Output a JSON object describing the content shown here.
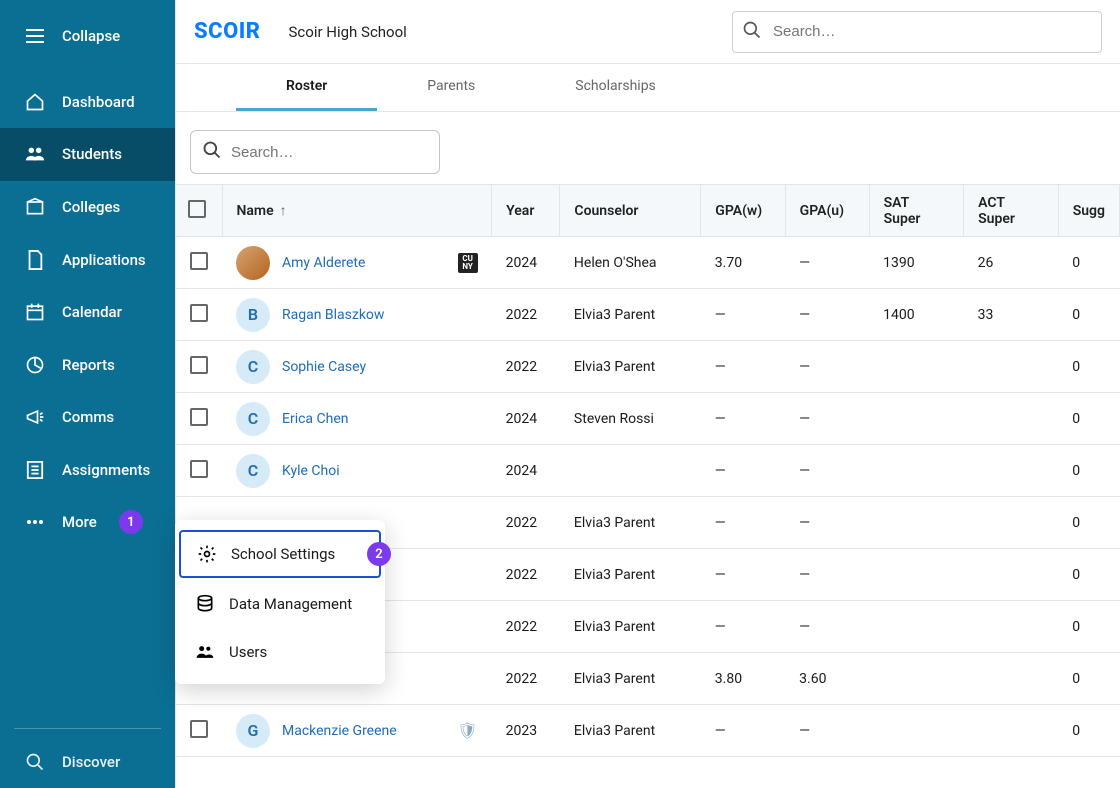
{
  "sidebar": {
    "collapse": "Collapse",
    "items": [
      {
        "label": "Dashboard"
      },
      {
        "label": "Students"
      },
      {
        "label": "Colleges"
      },
      {
        "label": "Applications"
      },
      {
        "label": "Calendar"
      },
      {
        "label": "Reports"
      },
      {
        "label": "Comms"
      },
      {
        "label": "Assignments"
      },
      {
        "label": "More"
      }
    ],
    "discover": "Discover"
  },
  "popover": {
    "items": [
      {
        "label": "School Settings"
      },
      {
        "label": "Data Management"
      },
      {
        "label": "Users"
      }
    ]
  },
  "steps": {
    "one": "1",
    "two": "2"
  },
  "header": {
    "logo": "SCOIR",
    "school": "Scoir High School",
    "search_placeholder": "Search…"
  },
  "tabs": [
    {
      "label": "Roster",
      "active": true
    },
    {
      "label": "Parents"
    },
    {
      "label": "Scholarships"
    }
  ],
  "filter_search_placeholder": "Search…",
  "columns": [
    "Name",
    "Year",
    "Counselor",
    "GPA(w)",
    "GPA(u)",
    "SAT Super",
    "ACT Super",
    "Sugg"
  ],
  "rows": [
    {
      "initial": "",
      "photo": true,
      "name": "Amy Alderete",
      "badge": "CUNY",
      "year": "2024",
      "counselor": "Helen O'Shea",
      "gpaw": "3.70",
      "gpau": "—",
      "sat": "1390",
      "act": "26",
      "sugg": "0"
    },
    {
      "initial": "B",
      "name": "Ragan Blaszkow",
      "year": "2022",
      "counselor": "Elvia3 Parent",
      "gpaw": "—",
      "gpau": "—",
      "sat": "1400",
      "act": "33",
      "sugg": "0"
    },
    {
      "initial": "C",
      "name": "Sophie Casey",
      "year": "2022",
      "counselor": "Elvia3 Parent",
      "gpaw": "—",
      "gpau": "—",
      "sat": "",
      "act": "",
      "sugg": "0"
    },
    {
      "initial": "C",
      "name": "Erica Chen",
      "year": "2024",
      "counselor": "Steven Rossi",
      "gpaw": "—",
      "gpau": "—",
      "sat": "",
      "act": "",
      "sugg": "0"
    },
    {
      "initial": "C",
      "name": "Kyle Choi",
      "year": "2024",
      "counselor": "",
      "gpaw": "—",
      "gpau": "—",
      "sat": "",
      "act": "",
      "sugg": "0"
    },
    {
      "initial": "",
      "hidden": true,
      "name": "",
      "year": "2022",
      "counselor": "Elvia3 Parent",
      "gpaw": "—",
      "gpau": "—",
      "sat": "",
      "act": "",
      "sugg": "0"
    },
    {
      "initial": "",
      "hidden": true,
      "name": "",
      "year": "2022",
      "counselor": "Elvia3 Parent",
      "gpaw": "—",
      "gpau": "—",
      "sat": "",
      "act": "",
      "sugg": "0"
    },
    {
      "initial": "",
      "hidden": true,
      "name": "",
      "year": "2022",
      "counselor": "Elvia3 Parent",
      "gpaw": "—",
      "gpau": "—",
      "sat": "",
      "act": "",
      "sugg": "0"
    },
    {
      "initial": "",
      "hidden": true,
      "name": "",
      "year": "2022",
      "counselor": "Elvia3 Parent",
      "gpaw": "3.80",
      "gpau": "3.60",
      "sat": "",
      "act": "",
      "sugg": "0"
    },
    {
      "initial": "G",
      "name": "Mackenzie Greene",
      "shield": true,
      "year": "2023",
      "counselor": "Elvia3 Parent",
      "gpaw": "—",
      "gpau": "—",
      "sat": "",
      "act": "",
      "sugg": "0"
    }
  ]
}
